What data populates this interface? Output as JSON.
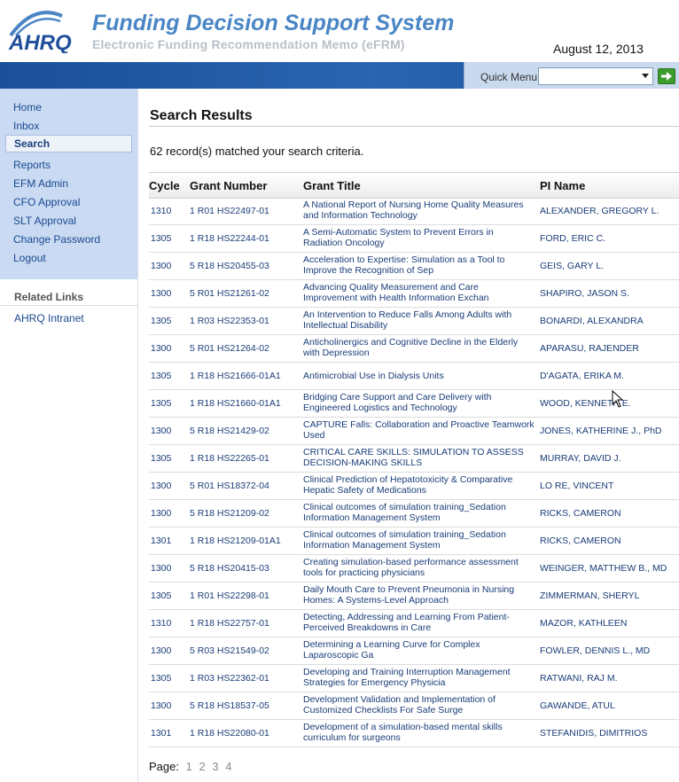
{
  "header": {
    "logo_text": "AHRQ",
    "title": "Funding Decision Support System",
    "subtitle": "Electronic Funding Recommendation Memo (eFRM)",
    "date": "August 12, 2013",
    "quick_menu_label": "Quick Menu:",
    "quick_menu_value": "",
    "go_icon": "arrow-right-icon"
  },
  "sidebar": {
    "items": [
      {
        "label": "Home"
      },
      {
        "label": "Inbox"
      },
      {
        "label": "Search",
        "active": true
      },
      {
        "label": "Reports"
      },
      {
        "label": "EFM Admin"
      },
      {
        "label": "CFO Approval"
      },
      {
        "label": "SLT Approval"
      },
      {
        "label": "Change Password"
      },
      {
        "label": "Logout"
      }
    ],
    "related_heading": "Related Links",
    "related_links": [
      {
        "label": "AHRQ Intranet"
      }
    ]
  },
  "main": {
    "title": "Search Results",
    "record_count": "62 record(s) matched your search criteria.",
    "columns": [
      "Cycle",
      "Grant Number",
      "Grant Title",
      "PI Name"
    ],
    "rows": [
      {
        "cycle": "1310",
        "grant": "1 R01 HS22497-01",
        "title": "A National Report of Nursing Home Quality Measures and Information Technology",
        "pi": "ALEXANDER, GREGORY L."
      },
      {
        "cycle": "1305",
        "grant": "1 R18 HS22244-01",
        "title": "A Semi-Automatic System to Prevent Errors in Radiation Oncology",
        "pi": "FORD, ERIC C."
      },
      {
        "cycle": "1300",
        "grant": "5 R18 HS20455-03",
        "title": "Acceleration to Expertise: Simulation as a Tool to Improve the Recognition of Sep",
        "pi": "GEIS, GARY L."
      },
      {
        "cycle": "1300",
        "grant": "5 R01 HS21261-02",
        "title": "Advancing Quality Measurement and Care Improvement with Health Information Exchan",
        "pi": "SHAPIRO, JASON S."
      },
      {
        "cycle": "1305",
        "grant": "1 R03 HS22353-01",
        "title": "An Intervention to Reduce Falls Among Adults with Intellectual Disability",
        "pi": "BONARDI, ALEXANDRA"
      },
      {
        "cycle": "1300",
        "grant": "5 R01 HS21264-02",
        "title": "Anticholinergics and Cognitive Decline in the Elderly with Depression",
        "pi": "APARASU, RAJENDER"
      },
      {
        "cycle": "1305",
        "grant": "1 R18 HS21666-01A1",
        "title": "Antimicrobial Use in Dialysis Units",
        "pi": "D'AGATA, ERIKA M."
      },
      {
        "cycle": "1305",
        "grant": "1 R18 HS21660-01A1",
        "title": "Bridging Care Support and Care Delivery with Engineered Logistics and Technology",
        "pi": "WOOD, KENNETH E."
      },
      {
        "cycle": "1300",
        "grant": "5 R18 HS21429-02",
        "title": "CAPTURE Falls: Collaboration and Proactive Teamwork Used",
        "pi": "JONES, KATHERINE J., PhD"
      },
      {
        "cycle": "1305",
        "grant": "1 R18 HS22265-01",
        "title": "CRITICAL CARE SKILLS: SIMULATION TO ASSESS DECISION-MAKING SKILLS",
        "pi": "MURRAY, DAVID J."
      },
      {
        "cycle": "1300",
        "grant": "5 R01 HS18372-04",
        "title": "Clinical Prediction of Hepatotoxicity & Comparative Hepatic Safety of Medications",
        "pi": "LO RE, VINCENT"
      },
      {
        "cycle": "1300",
        "grant": "5 R18 HS21209-02",
        "title": "Clinical outcomes of simulation training_Sedation Information Management System",
        "pi": "RICKS, CAMERON"
      },
      {
        "cycle": "1301",
        "grant": "1 R18 HS21209-01A1",
        "title": "Clinical outcomes of simulation training_Sedation Information Management System",
        "pi": "RICKS, CAMERON"
      },
      {
        "cycle": "1300",
        "grant": "5 R18 HS20415-03",
        "title": "Creating simulation-based performance assessment tools for practicing physicians",
        "pi": "WEINGER, MATTHEW B., MD"
      },
      {
        "cycle": "1305",
        "grant": "1 R01 HS22298-01",
        "title": "Daily Mouth Care to Prevent Pneumonia in Nursing Homes: A Systems-Level Approach",
        "pi": "ZIMMERMAN, SHERYL"
      },
      {
        "cycle": "1310",
        "grant": "1 R18 HS22757-01",
        "title": "Detecting, Addressing and Learning From Patient-Perceived Breakdowns in Care",
        "pi": "MAZOR, KATHLEEN"
      },
      {
        "cycle": "1300",
        "grant": "5 R03 HS21549-02",
        "title": "Determining a Learning Curve for Complex Laparoscopic Ga",
        "pi": "FOWLER, DENNIS L., MD"
      },
      {
        "cycle": "1305",
        "grant": "1 R03 HS22362-01",
        "title": "Developing and Training Interruption Management Strategies for Emergency Physicia",
        "pi": "RATWANI, RAJ M."
      },
      {
        "cycle": "1300",
        "grant": "5 R18 HS18537-05",
        "title": "Development Validation and Implementation of Customized Checklists For Safe Surge",
        "pi": "GAWANDE, ATUL"
      },
      {
        "cycle": "1301",
        "grant": "1 R18 HS22080-01",
        "title": "Development of a simulation-based mental skills curriculum for surgeons",
        "pi": "STEFANIDIS, DIMITRIOS"
      }
    ],
    "pager_label": "Page:",
    "pages": [
      "1",
      "2",
      "3",
      "4"
    ]
  },
  "colors": {
    "title_blue": "#4a86c5",
    "stripe_blue": "#2a65b0",
    "nav_bg": "#c9daf2",
    "link_blue": "#1a3d78",
    "go_green": "#3c9c2d"
  }
}
